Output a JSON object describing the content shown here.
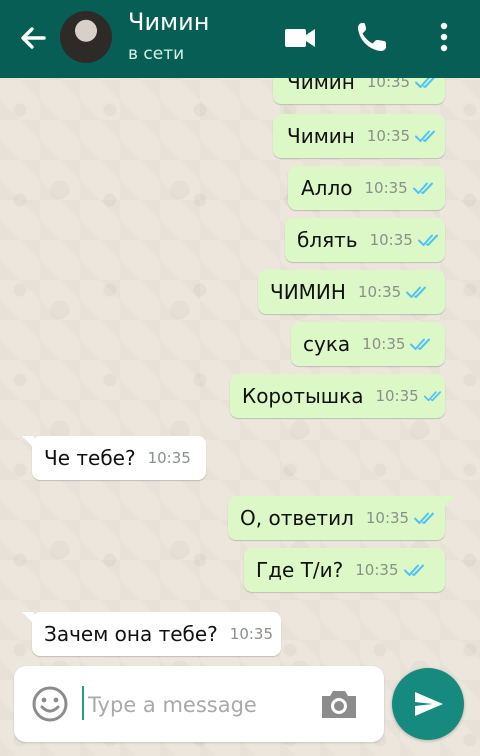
{
  "colors": {
    "header": "#075e54",
    "outgoing_bubble": "#dcf8c6",
    "incoming_bubble": "#ffffff",
    "read_ticks": "#4fc3f7",
    "send_button": "#168a7e"
  },
  "header": {
    "contact_name": "Чимин",
    "status": "в сети",
    "icons": [
      "back-arrow-icon",
      "avatar",
      "video-call-icon",
      "phone-icon",
      "more-vertical-icon"
    ]
  },
  "messages": [
    {
      "direction": "out",
      "text": "Чимин",
      "time": "10:35",
      "status": "read"
    },
    {
      "direction": "out",
      "text": "Чимин",
      "time": "10:35",
      "status": "read"
    },
    {
      "direction": "out",
      "text": "Алло",
      "time": "10:35",
      "status": "read"
    },
    {
      "direction": "out",
      "text": "блять",
      "time": "10:35",
      "status": "read"
    },
    {
      "direction": "out",
      "text": "ЧИМИН",
      "time": "10:35",
      "status": "read"
    },
    {
      "direction": "out",
      "text": "сука",
      "time": "10:35",
      "status": "read"
    },
    {
      "direction": "out",
      "text": "Коротышка",
      "time": "10:35",
      "status": "read"
    },
    {
      "direction": "in",
      "text": "Че тебе?",
      "time": "10:35"
    },
    {
      "direction": "out",
      "text": "О, ответил",
      "time": "10:35",
      "status": "read"
    },
    {
      "direction": "out",
      "text": "Где Т/и?",
      "time": "10:35",
      "status": "read"
    },
    {
      "direction": "in",
      "text": "Зачем она тебе?",
      "time": "10:35"
    }
  ],
  "composer": {
    "placeholder": "Type a message",
    "value": "",
    "icons": [
      "emoji-icon",
      "camera-icon",
      "send-icon"
    ]
  }
}
